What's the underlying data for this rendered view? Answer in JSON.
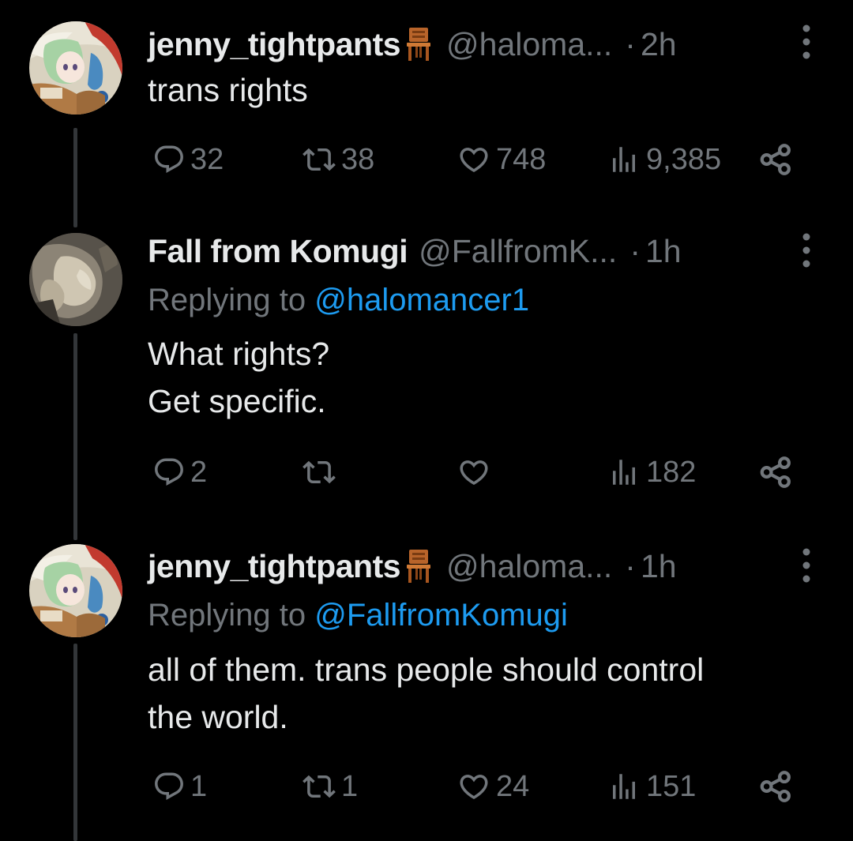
{
  "colors": {
    "background": "#000000",
    "text_primary": "#e7e9ea",
    "text_secondary": "#71767b",
    "link": "#1d9bf0",
    "thread_line": "#333639"
  },
  "tweets": [
    {
      "display_name": "jenny_tightpants",
      "name_emoji": "chair-icon",
      "handle": "@haloma...",
      "separator": "·",
      "time": "2h",
      "replying_label": "",
      "replying_to": "",
      "text": "trans rights",
      "actions": {
        "reply_count": "32",
        "retweet_count": "38",
        "like_count": "748",
        "view_count": "9,385"
      }
    },
    {
      "display_name": "Fall from Komugi",
      "name_emoji": "",
      "handle": "@FallfromK...",
      "separator": "·",
      "time": "1h",
      "replying_label": "Replying to ",
      "replying_to": "@halomancer1",
      "text": "What rights?\nGet specific.",
      "actions": {
        "reply_count": "2",
        "retweet_count": "",
        "like_count": "",
        "view_count": "182"
      }
    },
    {
      "display_name": "jenny_tightpants",
      "name_emoji": "chair-icon",
      "handle": "@haloma...",
      "separator": "·",
      "time": "1h",
      "replying_label": "Replying to ",
      "replying_to": "@FallfromKomugi",
      "text": "all of them. trans people should control\nthe world.",
      "actions": {
        "reply_count": "1",
        "retweet_count": "1",
        "like_count": "24",
        "view_count": "151"
      }
    }
  ]
}
